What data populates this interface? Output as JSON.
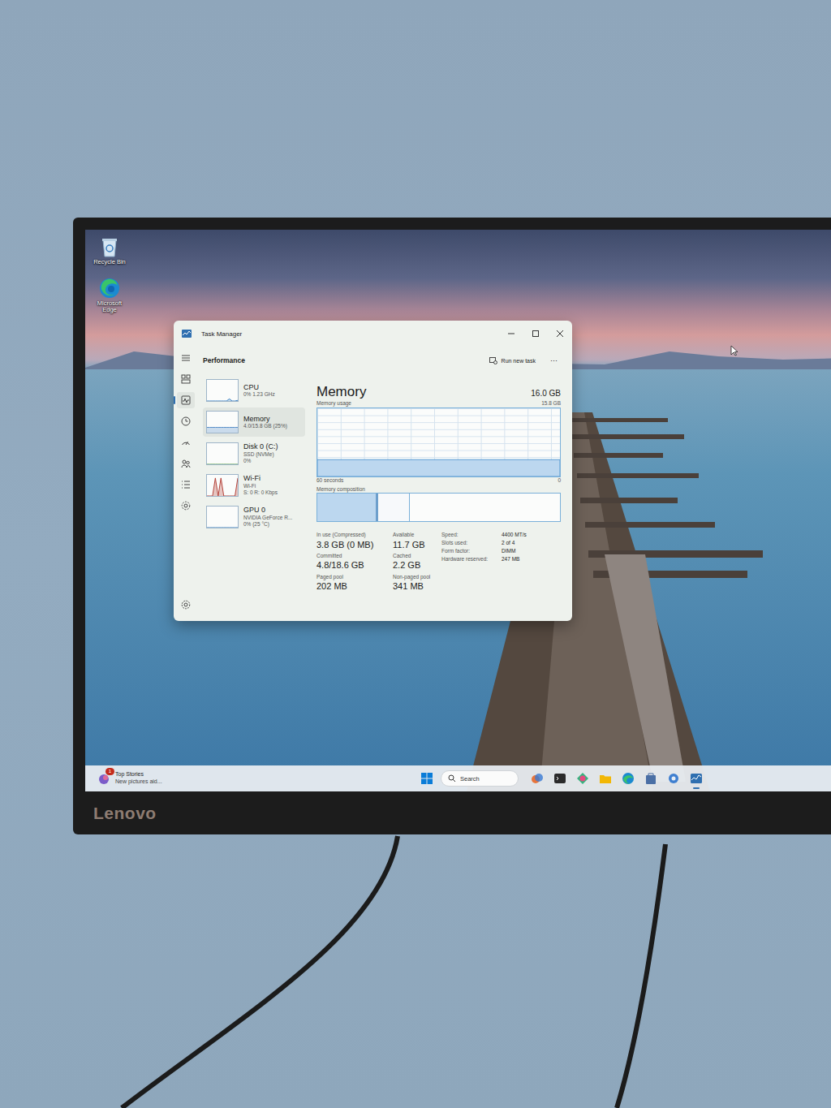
{
  "monitor": {
    "brand": "Lenovo"
  },
  "desktop": {
    "icons": [
      {
        "label": "Recycle Bin"
      },
      {
        "label": "Microsoft Edge"
      }
    ]
  },
  "window": {
    "title": "Task Manager"
  },
  "nav_rail": [
    {
      "selected": false
    },
    {
      "selected": true
    },
    {
      "selected": false
    },
    {
      "selected": false
    },
    {
      "selected": false
    },
    {
      "selected": false
    },
    {
      "selected": false
    }
  ],
  "header": {
    "title": "Performance",
    "run_task": "Run new task",
    "more": "···"
  },
  "sidebar": {
    "items": [
      {
        "name": "CPU",
        "lines": [
          "0% 1.23 GHz"
        ],
        "selected": false,
        "color": "#3b82c4",
        "values": [
          0,
          0,
          0,
          0,
          0,
          0,
          0,
          0,
          0.1,
          0,
          0,
          0.03
        ]
      },
      {
        "name": "Memory",
        "lines": [
          "4.0/15.8 GB (25%)"
        ],
        "selected": true,
        "color": "#5a8fc9",
        "values": [
          0.25,
          0.25,
          0.25,
          0.25,
          0.25,
          0.25,
          0.25,
          0.25,
          0.25,
          0.25,
          0.25,
          0.25
        ]
      },
      {
        "name": "Disk 0 (C:)",
        "lines": [
          "SSD (NVMe)",
          "0%"
        ],
        "selected": false,
        "color": "#4c9a3a",
        "values": [
          0,
          0,
          0,
          0,
          0,
          0,
          0,
          0,
          0,
          0,
          0,
          0
        ]
      },
      {
        "name": "Wi-Fi",
        "lines": [
          "Wi-Fi",
          "S: 0 R: 0 Kbps"
        ],
        "selected": false,
        "color": "#b5443c",
        "values": [
          0,
          0,
          0,
          0.85,
          0,
          0.85,
          0,
          0,
          0,
          0,
          0,
          0.85
        ]
      },
      {
        "name": "GPU 0",
        "lines": [
          "NVIDIA GeForce R...",
          "0% (25 °C)"
        ],
        "selected": false,
        "color": "#3b82c4",
        "values": [
          0,
          0,
          0,
          0,
          0,
          0,
          0,
          0,
          0,
          0,
          0,
          0
        ]
      }
    ]
  },
  "detail": {
    "title": "Memory",
    "total": "16.0 GB",
    "usage_label": "Memory usage",
    "usage_max": "15.8 GB",
    "usage_values": [
      3.9,
      3.9,
      3.9,
      3.9,
      3.9,
      3.9,
      3.9,
      3.9,
      3.9,
      3.9,
      3.9,
      3.9,
      3.9,
      3.9,
      3.9,
      3.9,
      3.9,
      3.9,
      3.9,
      3.9,
      3.9,
      3.9,
      3.9,
      3.9,
      3.9,
      3.9,
      3.9,
      3.9,
      3.9,
      3.9
    ],
    "axis_left": "60 seconds",
    "axis_right": "0",
    "composition_label": "Memory composition",
    "composition": [
      {
        "kind": "in_use",
        "level": 0.24
      },
      {
        "kind": "modified",
        "level": 0.01
      },
      {
        "kind": "standby",
        "level": 0.13
      },
      {
        "kind": "free",
        "level": 0.62
      }
    ],
    "stats": [
      {
        "label": "In use (Compressed)",
        "value": "3.8 GB (0 MB)"
      },
      {
        "label": "Available",
        "value": "11.7 GB"
      },
      {
        "label": "Committed",
        "value": "4.8/18.6 GB"
      },
      {
        "label": "Cached",
        "value": "2.2 GB"
      },
      {
        "label": "Paged pool",
        "value": "202 MB"
      },
      {
        "label": "Non-paged pool",
        "value": "341 MB"
      }
    ],
    "specs": [
      {
        "label": "Speed:",
        "value": "4400 MT/s"
      },
      {
        "label": "Slots used:",
        "value": "2 of 4"
      },
      {
        "label": "Form factor:",
        "value": "DIMM"
      },
      {
        "label": "Hardware reserved:",
        "value": "247 MB"
      }
    ]
  },
  "taskbar": {
    "widget": {
      "badge": "1",
      "title": "Top Stories",
      "subtitle": "New pictures aid..."
    },
    "search": {
      "placeholder": "Search"
    },
    "apps": [
      {
        "active": false
      },
      {
        "active": false
      },
      {
        "active": false
      },
      {
        "active": false
      },
      {
        "active": false
      },
      {
        "active": false
      },
      {
        "active": false
      },
      {
        "active": true
      }
    ]
  }
}
